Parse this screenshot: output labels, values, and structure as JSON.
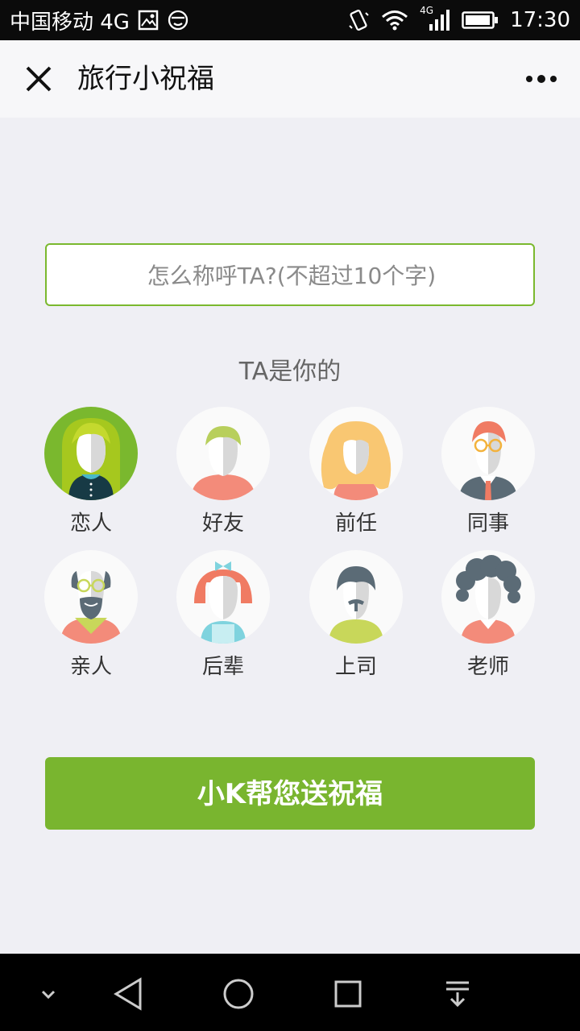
{
  "status_bar": {
    "carrier": "中国移动 4G",
    "network_small": "4G",
    "time": "17:30"
  },
  "header": {
    "title": "旅行小祝福"
  },
  "form": {
    "name_placeholder": "怎么称呼TA?(不超过10个字)",
    "relation_prompt": "TA是你的"
  },
  "relations": [
    {
      "label": "恋人",
      "selected": true
    },
    {
      "label": "好友",
      "selected": false
    },
    {
      "label": "前任",
      "selected": false
    },
    {
      "label": "同事",
      "selected": false
    },
    {
      "label": "亲人",
      "selected": false
    },
    {
      "label": "后辈",
      "selected": false
    },
    {
      "label": "上司",
      "selected": false
    },
    {
      "label": "老师",
      "selected": false
    }
  ],
  "actions": {
    "send_label": "小K帮您送祝福"
  },
  "colors": {
    "accent": "#79b52f",
    "background": "#efeff4"
  }
}
